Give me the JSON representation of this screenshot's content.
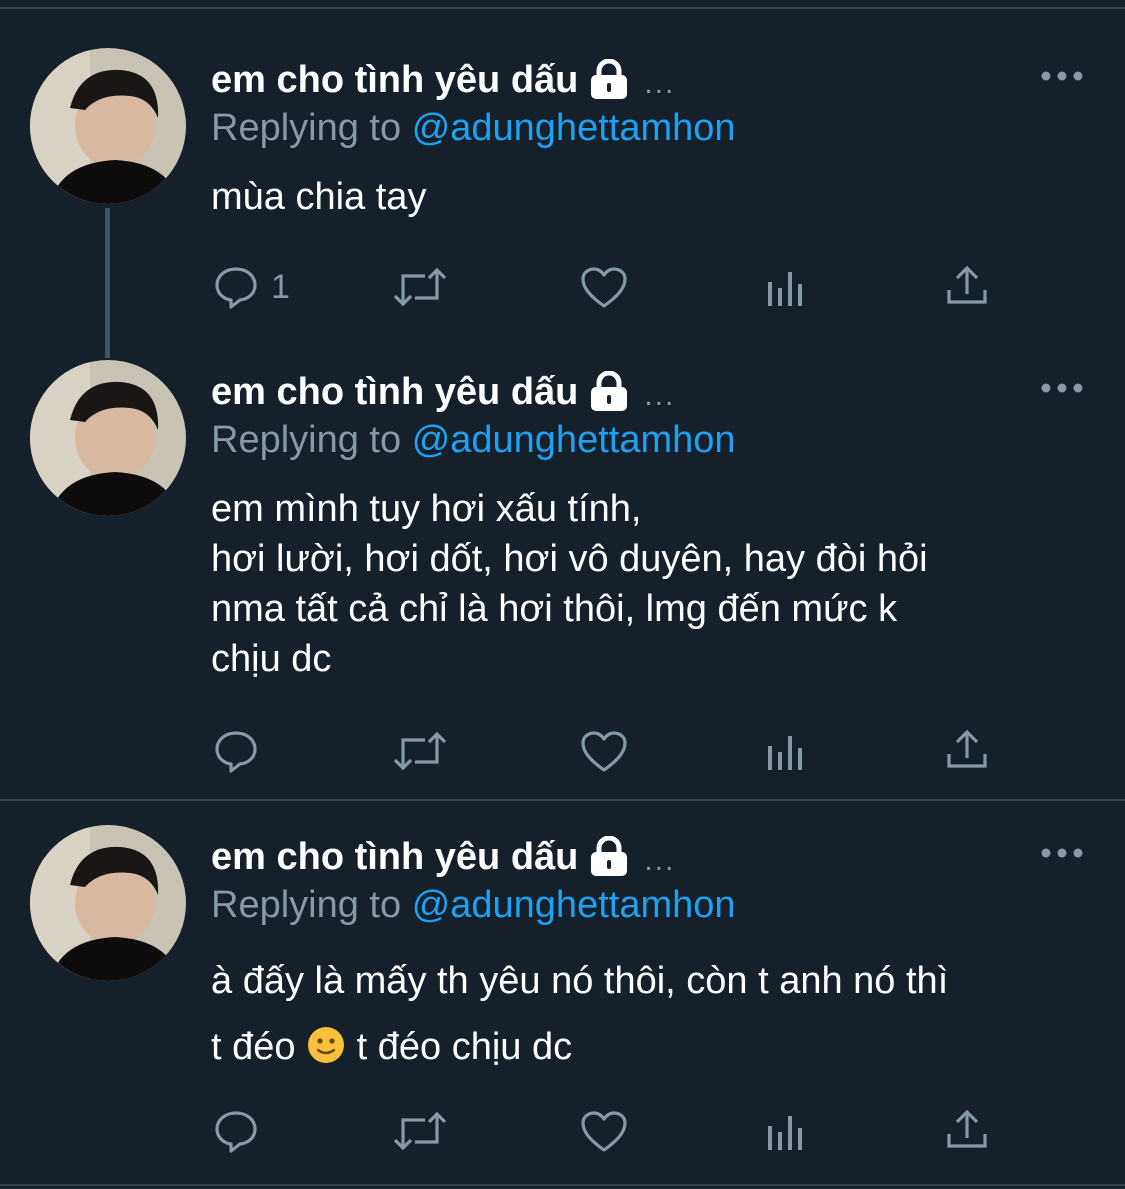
{
  "tweets": [
    {
      "display_name": "em cho tình yêu dấu",
      "more_indicator": "...",
      "replying_prefix": "Replying to",
      "replying_handle": "@adunghettamhon",
      "text": "mùa chia tay",
      "reply_count": "1"
    },
    {
      "display_name": "em cho tình yêu dấu",
      "more_indicator": "...",
      "replying_prefix": "Replying to",
      "replying_handle": "@adunghettamhon",
      "text": "em mình tuy hơi xấu tính,\nhơi lười, hơi dốt, hơi vô duyên, hay đòi hỏi\nnma tất cả chỉ là hơi thôi, lmg đến mức k\nchịu dc",
      "reply_count": ""
    },
    {
      "display_name": "em cho tình yêu dấu",
      "more_indicator": "...",
      "replying_prefix": "Replying to",
      "replying_handle": "@adunghettamhon",
      "text_part1": "à đấy là mấy th yêu nó thôi, còn t anh nó thì\nt đéo ",
      "text_part2": "  t đéo chịu dc",
      "reply_count": ""
    }
  ],
  "icons": {
    "lock": "lock-icon",
    "more": "more-dots-icon",
    "reply": "reply-icon",
    "retweet": "retweet-icon",
    "like": "heart-icon",
    "analytics": "analytics-icon",
    "share": "share-icon",
    "emoji": "slightly-smiling-face-emoji"
  },
  "colors": {
    "background": "#15202b",
    "divider": "#38444d",
    "secondary_text": "#8899a6",
    "link": "#1da1f2",
    "thread_line": "#3d5466"
  }
}
